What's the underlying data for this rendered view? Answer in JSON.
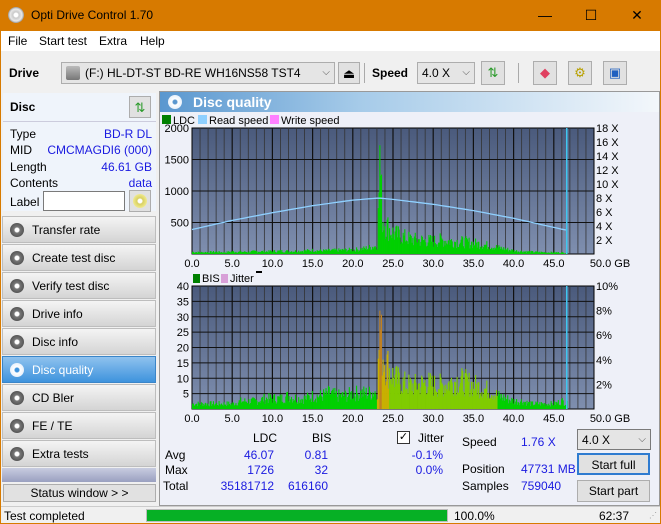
{
  "window": {
    "title": "Opti Drive Control 1.70",
    "minimize": "—",
    "maximize": "☐",
    "close": "✕"
  },
  "menu": [
    "File",
    "Start test",
    "Extra",
    "Help"
  ],
  "toolbar": {
    "drive_label": "Drive",
    "drive_value": "(F:)  HL-DT-ST BD-RE  WH16NS58 TST4",
    "speed_label": "Speed",
    "speed_value": "4.0 X"
  },
  "disc": {
    "header": "Disc",
    "rows": [
      {
        "label": "Type",
        "value": "BD-R DL"
      },
      {
        "label": "MID",
        "value": "CMCMAGDI6 (000)"
      },
      {
        "label": "Length",
        "value": "46.61 GB"
      },
      {
        "label": "Contents",
        "value": "data"
      }
    ],
    "label_field_label": "Label",
    "label_field_value": ""
  },
  "nav": [
    {
      "label": "Transfer rate",
      "active": false
    },
    {
      "label": "Create test disc",
      "active": false
    },
    {
      "label": "Verify test disc",
      "active": false
    },
    {
      "label": "Drive info",
      "active": false
    },
    {
      "label": "Disc info",
      "active": false
    },
    {
      "label": "Disc quality",
      "active": true
    },
    {
      "label": "CD Bler",
      "active": false
    },
    {
      "label": "FE / TE",
      "active": false
    },
    {
      "label": "Extra tests",
      "active": false
    }
  ],
  "status_window_button": "Status window > >",
  "panel_title": "Disc quality",
  "colors": {
    "ldc": "#008000",
    "read_speed": "#8fd0ff",
    "write_speed": "#ff80ff",
    "bis": "#008000",
    "jitter": "#d8a0d8",
    "plot_bg_top": "#4a5a7c",
    "plot_bg_bottom": "#7f8faf",
    "bar_green": "#00d000",
    "accent": "#3e93dd"
  },
  "chart_data": [
    {
      "type": "bar",
      "title": "LDC / Read speed",
      "legend": [
        "LDC",
        "Read speed",
        "Write speed"
      ],
      "legend_position": "top-left",
      "xlabel": "GB",
      "xlim": [
        0,
        50
      ],
      "x_ticks": [
        "0.0",
        "5.0",
        "10.0",
        "15.0",
        "20.0",
        "25.0",
        "30.0",
        "35.0",
        "40.0",
        "45.0",
        "50.0 GB"
      ],
      "ylim": [
        0,
        2000
      ],
      "y_ticks": [
        "500",
        "1000",
        "1500",
        "2000"
      ],
      "y2lim": [
        0,
        18
      ],
      "y2_ticks": [
        "2 X",
        "4 X",
        "6 X",
        "8 X",
        "10 X",
        "12 X",
        "14 X",
        "16 X",
        "18 X"
      ],
      "grid": true,
      "end_marker_gb": 46.61,
      "ldc_series": {
        "x": [
          0,
          1,
          2,
          3,
          4,
          5,
          6,
          7,
          8,
          9,
          10,
          11,
          12,
          13,
          14,
          15,
          16,
          17,
          18,
          19,
          20,
          21,
          22,
          23,
          23.3,
          23.6,
          24,
          25,
          26,
          27,
          28,
          29,
          30,
          31,
          32,
          33,
          34,
          35,
          36,
          37,
          38,
          39,
          40,
          41,
          42,
          43,
          44,
          45,
          46,
          46.6
        ],
        "values": [
          40,
          30,
          35,
          40,
          30,
          45,
          40,
          40,
          50,
          45,
          50,
          55,
          50,
          55,
          60,
          70,
          60,
          65,
          70,
          75,
          80,
          90,
          120,
          160,
          1726,
          700,
          550,
          380,
          330,
          280,
          260,
          250,
          240,
          260,
          240,
          230,
          220,
          200,
          180,
          150,
          120,
          90,
          60,
          50,
          40,
          35,
          30,
          30,
          25,
          20
        ]
      },
      "read_speed_series": {
        "x": [
          0,
          5,
          10,
          15,
          20,
          23.3,
          25,
          30,
          35,
          40,
          45,
          46.6
        ],
        "values": [
          3.5,
          4.8,
          5.9,
          6.9,
          7.7,
          8.0,
          7.8,
          7.1,
          6.2,
          5.1,
          3.8,
          3.4
        ]
      }
    },
    {
      "type": "bar",
      "title": "BIS / Jitter",
      "legend": [
        "BIS",
        "Jitter"
      ],
      "legend_position": "top-left",
      "xlabel": "GB",
      "xlim": [
        0,
        50
      ],
      "x_ticks": [
        "0.0",
        "5.0",
        "10.0",
        "15.0",
        "20.0",
        "25.0",
        "30.0",
        "35.0",
        "40.0",
        "45.0",
        "50.0 GB"
      ],
      "ylim": [
        0,
        40
      ],
      "y_ticks": [
        "5",
        "10",
        "15",
        "20",
        "25",
        "30",
        "35",
        "40"
      ],
      "y2lim": [
        0,
        10
      ],
      "y2_ticks": [
        "2%",
        "4%",
        "6%",
        "8%",
        "10%"
      ],
      "grid": true,
      "end_marker_gb": 46.61,
      "bis_series": {
        "x": [
          0,
          1,
          2,
          3,
          4,
          5,
          6,
          7,
          8,
          9,
          10,
          11,
          12,
          13,
          14,
          15,
          16,
          17,
          18,
          19,
          20,
          21,
          22,
          23,
          23.3,
          23.6,
          24,
          25,
          26,
          27,
          28,
          29,
          30,
          31,
          32,
          33,
          34,
          35,
          36,
          37,
          38,
          39,
          40,
          41,
          42,
          43,
          44,
          45,
          46,
          46.6
        ],
        "values": [
          2,
          2,
          2,
          2,
          2,
          2,
          3,
          3,
          3,
          4,
          4,
          4,
          5,
          4,
          4,
          5,
          5,
          6,
          5,
          5,
          6,
          6,
          6,
          7,
          32,
          22,
          18,
          12,
          10,
          9,
          9,
          10,
          9,
          9,
          10,
          11,
          10,
          9,
          8,
          7,
          5,
          4,
          3,
          3,
          2,
          2,
          2,
          2,
          3,
          2
        ]
      }
    }
  ],
  "stats": {
    "col_ldc": "LDC",
    "col_bis": "BIS",
    "jitter_label": "Jitter",
    "jitter_checked": true,
    "rows": [
      {
        "label": "Avg",
        "ldc": "46.07",
        "bis": "0.81",
        "jitter": "-0.1%"
      },
      {
        "label": "Max",
        "ldc": "1726",
        "bis": "32",
        "jitter": "0.0%"
      },
      {
        "label": "Total",
        "ldc": "35181712",
        "bis": "616160",
        "jitter": ""
      }
    ],
    "speed_label": "Speed",
    "speed_value": "1.76 X",
    "position_label": "Position",
    "position_value": "47731 MB",
    "samples_label": "Samples",
    "samples_value": "759040",
    "speed_select": "4.0 X",
    "start_full": "Start full",
    "start_part": "Start part"
  },
  "statusbar": {
    "text": "Test completed",
    "progress": 100.0,
    "progress_text": "100.0%",
    "elapsed": "62:37"
  }
}
